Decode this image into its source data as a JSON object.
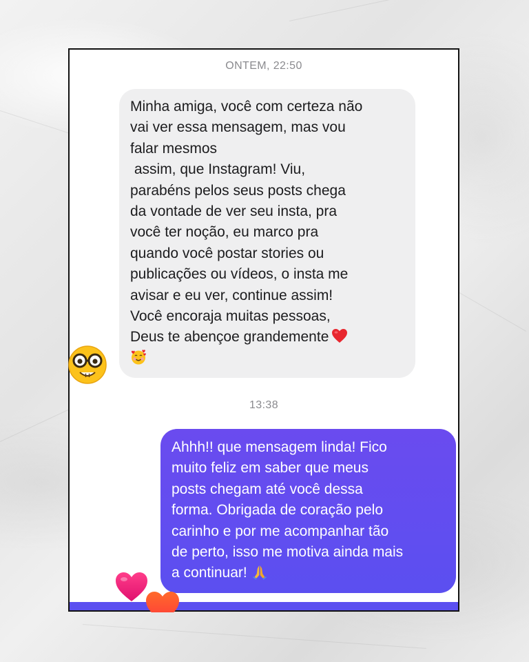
{
  "conversation": {
    "timestamp_top": "ONTEM, 22:50",
    "timestamp_mid": "13:38",
    "incoming": {
      "text": "Minha amiga, você com certeza não\nvai ver essa mensagem, mas vou\nfalar mesmos\n assim, que Instagram! Viu,\nparabéns pelos seus posts chega\nda vontade de ver seu insta, pra\nvocê ter noção, eu marco pra\nquando você postar stories ou\npublicações ou vídeos, o insta me\navisar e eu ver, continue assim!\nVocê encoraja muitas pessoas,\nDeus te abençoe grandemente",
      "trailing_emojis": [
        "red-heart",
        "smiling-face-with-hearts"
      ],
      "reaction_emoji": "nerd-face"
    },
    "outgoing": {
      "text": "Ahhh!! que mensagem linda! Fico\nmuito feliz em saber que meus\nposts chegam até você dessa\nforma. Obrigada de coração pelo\ncarinho e por me acompanhar tão\nde perto, isso me motiva ainda mais\na continuar!",
      "trailing_emoji": "folded-hands"
    },
    "floating_hearts": [
      "pink-heart",
      "orange-heart"
    ]
  },
  "colors": {
    "outgoing_bubble": "#5b4ff0",
    "incoming_bubble": "#efeff0",
    "timestamp": "#8a8a8e",
    "frame_border": "#111111"
  }
}
